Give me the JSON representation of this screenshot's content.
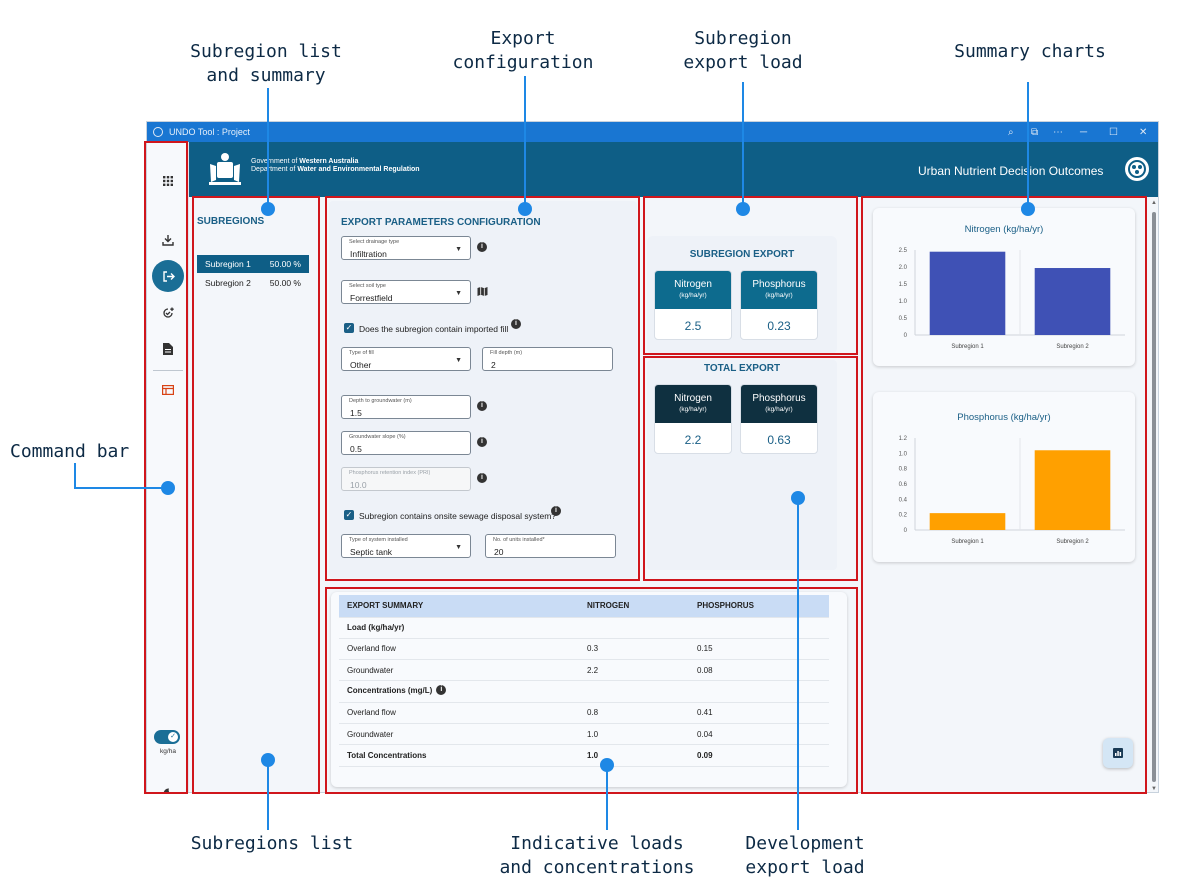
{
  "callouts": {
    "subregion_list_summary": [
      "Subregion list",
      "and summary"
    ],
    "export_configuration": [
      "Export",
      "configuration"
    ],
    "subregion_export_load": [
      "Subregion",
      "export load"
    ],
    "summary_charts": [
      "Summary charts"
    ],
    "command_bar": [
      "Command bar"
    ],
    "subregions_list": [
      "Subregions list"
    ],
    "indicative": [
      "Indicative loads",
      "and concentrations"
    ],
    "development": [
      "Development",
      "export load"
    ]
  },
  "window": {
    "title": "UNDO Tool : Project",
    "controls": [
      "⌕",
      "⧉",
      "⋯",
      "─",
      "☐",
      "✕"
    ]
  },
  "header": {
    "gov_line1_prefix": "Government of ",
    "gov_line1_bold": "Western Australia",
    "gov_line2_prefix": "Department of ",
    "gov_line2_bold": "Water and Environmental Regulation",
    "app_title": "Urban Nutrient Decision Outcomes"
  },
  "command_bar": {
    "icons": [
      "apps-grid-icon",
      "import-icon",
      "export-icon",
      "add-check-icon",
      "document-icon",
      "report-icon",
      "toggle-switch",
      "theme-icon"
    ],
    "unit_label": "kg/ha"
  },
  "subregions": {
    "title": "SUBREGIONS",
    "items": [
      {
        "name": "Subregion 1",
        "pct": "50.00 %",
        "selected": true
      },
      {
        "name": "Subregion 2",
        "pct": "50.00 %",
        "selected": false
      }
    ]
  },
  "config": {
    "title": "EXPORT PARAMETERS CONFIGURATION",
    "drainage": {
      "label": "Select drainage type",
      "value": "Infiltration"
    },
    "soil": {
      "label": "Select soil type",
      "value": "Forrestfield"
    },
    "imported_fill": "Does the subregion contain imported fill",
    "fill_type": {
      "label": "Type of fill",
      "value": "Other"
    },
    "fill_depth": {
      "label": "Fill depth (m)",
      "value": "2"
    },
    "depth_gw": {
      "label": "Depth to groundwater (m)",
      "value": "1.5"
    },
    "gw_slope": {
      "label": "Groundwater slope (%)",
      "value": "0.5"
    },
    "pri": {
      "label": "Phosphorus retention index (PRI)",
      "value": "10.0"
    },
    "sewage": "Subregion contains onsite sewage disposal system?",
    "system_type": {
      "label": "Type of system installed",
      "value": "Septic tank"
    },
    "units": {
      "label": "No. of units installed*",
      "value": "20"
    }
  },
  "subregion_export": {
    "title": "SUBREGION EXPORT",
    "nitrogen": {
      "label": "Nitrogen",
      "unit": "(kg/ha/yr)",
      "value": "2.5"
    },
    "phosphorus": {
      "label": "Phosphorus",
      "unit": "(kg/ha/yr)",
      "value": "0.23"
    }
  },
  "total_export": {
    "title": "TOTAL EXPORT",
    "nitrogen": {
      "label": "Nitrogen",
      "unit": "(kg/ha/yr)",
      "value": "2.2"
    },
    "phosphorus": {
      "label": "Phosphorus",
      "unit": "(kg/ha/yr)",
      "value": "0.63"
    }
  },
  "summary_table": {
    "headers": [
      "EXPORT SUMMARY",
      "NITROGEN",
      "PHOSPHORUS"
    ],
    "rows": [
      {
        "kind": "section",
        "cells": [
          "Load (kg/ha/yr)",
          "",
          ""
        ]
      },
      {
        "kind": "row",
        "cells": [
          "Overland flow",
          "0.3",
          "0.15"
        ]
      },
      {
        "kind": "row",
        "cells": [
          "Groundwater",
          "2.2",
          "0.08"
        ]
      },
      {
        "kind": "section",
        "cells": [
          "Concentrations (mg/L)",
          "",
          ""
        ]
      },
      {
        "kind": "row",
        "cells": [
          "Overland flow",
          "0.8",
          "0.41"
        ]
      },
      {
        "kind": "row",
        "cells": [
          "Groundwater",
          "1.0",
          "0.04"
        ]
      },
      {
        "kind": "total",
        "cells": [
          "Total Concentrations",
          "1.0",
          "0.09"
        ]
      }
    ]
  },
  "colors": {
    "nitrogen_bar": "#3f51b5",
    "phosphorus_bar": "#ffa000",
    "accent": "#1a5f86",
    "header": "#0e5e86",
    "tile_sub": "#0d6b8e",
    "tile_total": "#0f3040"
  },
  "chart_data": [
    {
      "type": "bar",
      "title": "Nitrogen (kg/ha/yr)",
      "categories": [
        "Subregion 1",
        "Subregion 2"
      ],
      "values": [
        2.45,
        1.97
      ],
      "ylim": [
        0,
        2.5
      ],
      "yticks": [
        0,
        0.5,
        1.0,
        1.5,
        2.0,
        2.5
      ],
      "yticklabels": [
        "0",
        "0.5",
        "1.0",
        "1.5",
        "2.0",
        "2.5"
      ],
      "color": "#3f51b5",
      "grid": false
    },
    {
      "type": "bar",
      "title": "Phosphorus (kg/ha/yr)",
      "categories": [
        "Subregion 1",
        "Subregion 2"
      ],
      "values": [
        0.22,
        1.04
      ],
      "ylim": [
        0,
        1.2
      ],
      "yticks": [
        0,
        0.2,
        0.4,
        0.6,
        0.8,
        1.0,
        1.2
      ],
      "yticklabels": [
        "0",
        "0.2",
        "0.4",
        "0.6",
        "0.8",
        "1.0",
        "1.2"
      ],
      "color": "#ffa000",
      "grid": false
    }
  ]
}
